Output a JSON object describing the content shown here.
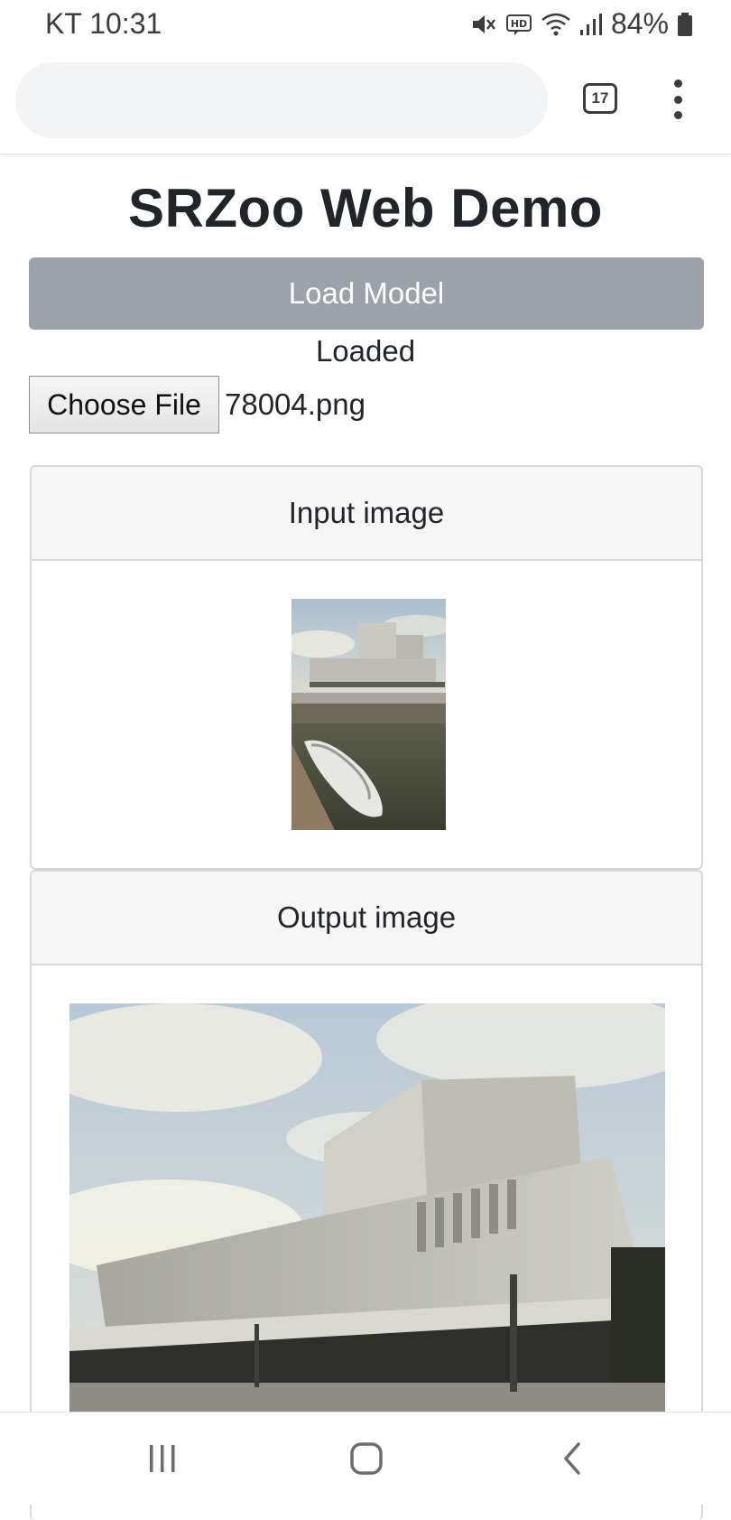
{
  "status_bar": {
    "time": "KT 10:31",
    "battery_percent": "84%",
    "icons": [
      "mute-icon",
      "hd-icon",
      "wifi-icon",
      "signal-icon",
      "battery-icon"
    ]
  },
  "browser": {
    "url": "",
    "tab_count": "17",
    "menu_icon": "more-vertical-icon"
  },
  "page": {
    "title": "SRZoo Web Demo",
    "load_button_label": "Load Model",
    "model_status": "Loaded",
    "file_input": {
      "button_label": "Choose File",
      "file_name": "78004.png"
    },
    "input_card": {
      "header": "Input image"
    },
    "output_card": {
      "header": "Output image"
    }
  },
  "nav_bar": {
    "icons": [
      "recents-icon",
      "home-icon",
      "back-icon"
    ]
  },
  "colors": {
    "load_button_bg": "#9da1a9",
    "card_header_bg": "#f6f6f6",
    "card_border": "#d8d8d8",
    "text": "#212529"
  }
}
